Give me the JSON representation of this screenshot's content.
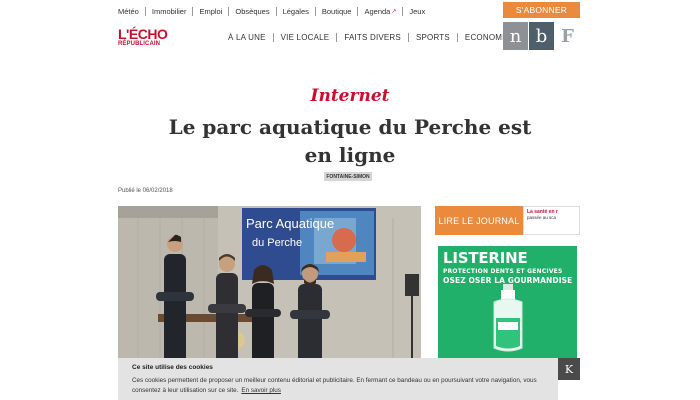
{
  "topnav": [
    "Météo",
    "Immobilier",
    "Emploi",
    "Obsèques",
    "Légales",
    "Boutique",
    "Agenda",
    "Jeux"
  ],
  "subscribe_label": "S'ABONNER",
  "logo": {
    "line1": "L'ÉCHO",
    "line2": "RÉPUBLICAIN"
  },
  "mainnav": [
    "À LA UNE",
    "VIE LOCALE",
    "FAITS DIVERS",
    "SPORTS",
    "ECONOMIE"
  ],
  "tiles": {
    "n": "n",
    "b": "b",
    "f": "F"
  },
  "article": {
    "kicker": "Internet",
    "title": "Le parc aquatique du Perche est en ligne",
    "tag": "FONTAINE-SIMON",
    "published": "Publié le 06/02/2018"
  },
  "photo": {
    "screen_line1": "Parc Aquatique",
    "screen_line2": "du Perche"
  },
  "sidebar": {
    "read_label": "LIRE LE JOURNAL",
    "paper_line1": "La santé en r",
    "paper_line2": "passée au sca",
    "ad_brand": "LISTERINE",
    "ad_line2": "PROTECTION DENTS ET GENCIVES",
    "ad_line3": "OSEZ OSER LA GOURMANDISE"
  },
  "cookie": {
    "heading": "Ce site utilise des cookies",
    "text": "Ces cookies permettent de proposer un meilleur contenu éditorial et publicitaire. En fermant ce bandeau ou en poursuivant votre navigation, vous consentez à leur utilisation sur ce site.",
    "link": "En savoir plus",
    "close": "K"
  },
  "colors": {
    "brand_red": "#c8102e",
    "orange": "#e98a3d",
    "ad_green": "#20b06a"
  }
}
